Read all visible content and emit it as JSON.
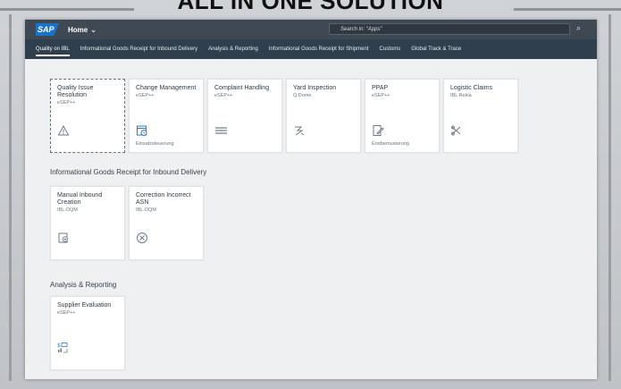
{
  "banner": {
    "headline": "ALL IN ONE SOLUTION"
  },
  "shell": {
    "logo_text": "SAP",
    "home_label": "Home",
    "search_placeholder": "Search in: \"Apps\""
  },
  "nav": {
    "items": [
      {
        "label": "Quality on IBL"
      },
      {
        "label": "Informational Goods Receipt for Inbound Delivery"
      },
      {
        "label": "Analysis & Reporting"
      },
      {
        "label": "Informational Goods Receipt for Shipment"
      },
      {
        "label": "Customs"
      },
      {
        "label": "Global Track & Trace"
      }
    ]
  },
  "sections": [
    {
      "title": "",
      "tiles": [
        {
          "title": "Quality Issue Resolution",
          "subtitle": "eSEP++",
          "icon": "warning-icon",
          "footer": ""
        },
        {
          "title": "Change Management",
          "subtitle": "eSEP++",
          "icon": "calendar-clock-icon",
          "footer": "Einsatzsteuerung"
        },
        {
          "title": "Complaint Handling",
          "subtitle": "eSEP++",
          "icon": "document-lines-icon",
          "footer": ""
        },
        {
          "title": "Yard Inspection",
          "subtitle": "Q.Dome",
          "icon": "inspection-icon",
          "footer": ""
        },
        {
          "title": "PPAP",
          "subtitle": "eSEP++",
          "icon": "edit-document-icon",
          "footer": "Erstbemusterung"
        },
        {
          "title": "Logistic Claims",
          "subtitle": "IBL Rekla",
          "icon": "scissors-icon",
          "footer": ""
        }
      ]
    },
    {
      "title": "Informational Goods Receipt for Inbound Delivery",
      "tiles": [
        {
          "title": "Manual Inbound Creation",
          "subtitle": "IBL-DQM",
          "icon": "add-document-icon",
          "footer": ""
        },
        {
          "title": "Correction Incorrect ASN",
          "subtitle": "IBL-DQM",
          "icon": "circle-x-icon",
          "footer": ""
        }
      ]
    },
    {
      "title": "Analysis & Reporting",
      "tiles": [
        {
          "title": "Supplier Evaluation",
          "subtitle": "eSEP++",
          "icon": "analytics-icon",
          "footer": ""
        }
      ]
    }
  ]
}
